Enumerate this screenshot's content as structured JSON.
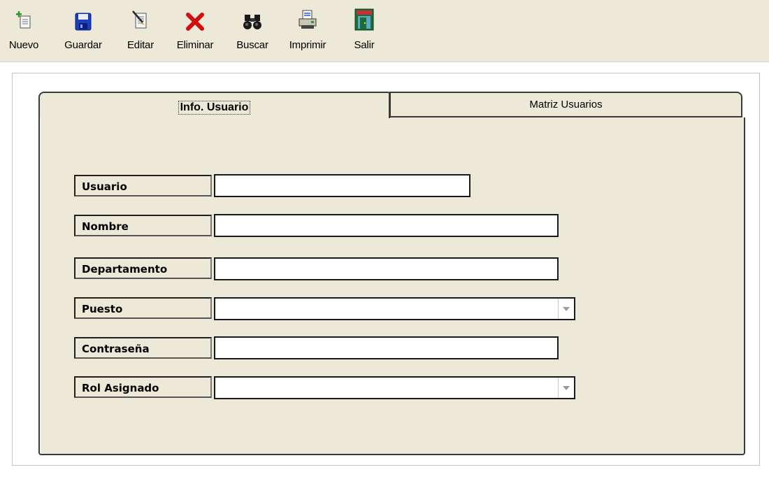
{
  "toolbar": {
    "buttons": [
      {
        "label": "Nuevo",
        "icon": "new-document-icon"
      },
      {
        "label": "Guardar",
        "icon": "save-disk-icon"
      },
      {
        "label": "Editar",
        "icon": "edit-document-icon"
      },
      {
        "label": "Eliminar",
        "icon": "delete-x-icon"
      },
      {
        "label": "Buscar",
        "icon": "binoculars-icon"
      },
      {
        "label": "Imprimir",
        "icon": "printer-icon"
      },
      {
        "label": "Salir",
        "icon": "exit-door-icon"
      }
    ]
  },
  "tabs": [
    {
      "label": "Info. Usuario",
      "active": true
    },
    {
      "label": "Matriz Usuarios",
      "active": false
    }
  ],
  "form": {
    "fields": [
      {
        "label": "Usuario",
        "value": "",
        "type": "text"
      },
      {
        "label": "Nombre",
        "value": "",
        "type": "text"
      },
      {
        "label": "Departamento",
        "value": "",
        "type": "text"
      },
      {
        "label": "Puesto",
        "value": "",
        "type": "select"
      },
      {
        "label": "Contraseña",
        "value": "",
        "type": "password"
      },
      {
        "label": "Rol Asignado",
        "value": "",
        "type": "select"
      }
    ]
  },
  "colors": {
    "panel_bg": "#ece9d8",
    "toolbar_bg": "#ece9d8",
    "delete_red": "#d01010",
    "save_blue": "#1c3fbf"
  }
}
